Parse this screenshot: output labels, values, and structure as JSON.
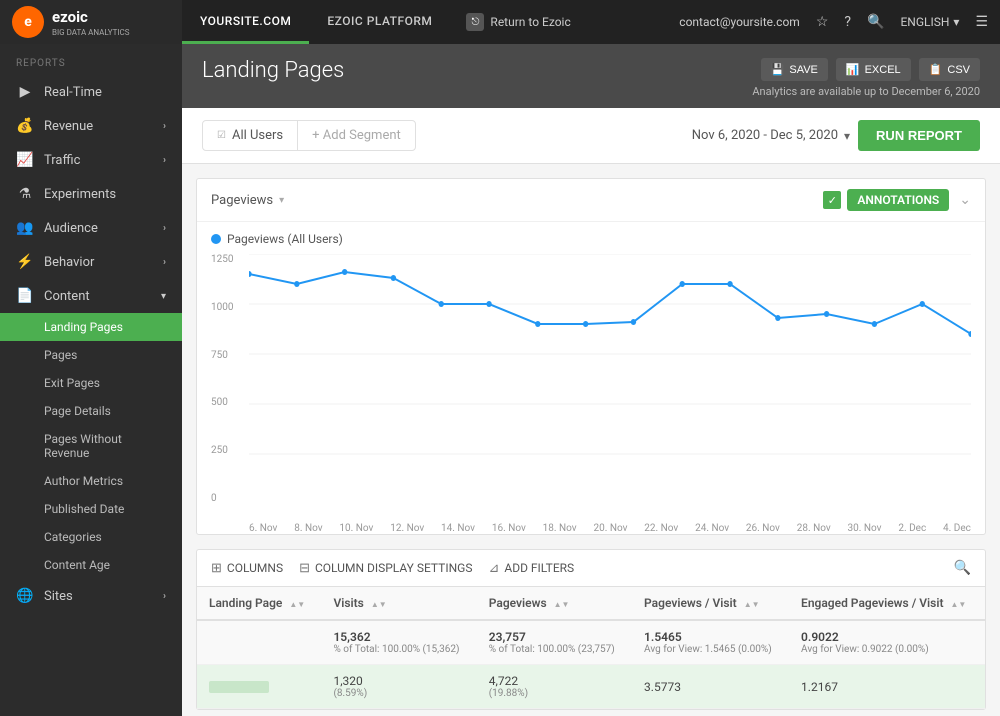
{
  "topNav": {
    "logo": {
      "letter": "e",
      "name": "ezoic",
      "sub": "BIG DATA ANALYTICS"
    },
    "tabs": [
      {
        "label": "YOURSITE.COM",
        "active": true
      },
      {
        "label": "EZOIC PLATFORM",
        "active": false
      }
    ],
    "returnLabel": "Return to Ezoic",
    "email": "contact@yoursite.com",
    "language": "ENGLISH"
  },
  "sidebar": {
    "sectionLabel": "REPORTS",
    "items": [
      {
        "label": "Real-Time",
        "icon": "▶",
        "hasArrow": false
      },
      {
        "label": "Revenue",
        "icon": "$",
        "hasArrow": true
      },
      {
        "label": "Traffic",
        "icon": "↑",
        "hasArrow": true
      },
      {
        "label": "Experiments",
        "icon": "⚗",
        "hasArrow": false
      },
      {
        "label": "Audience",
        "icon": "👥",
        "hasArrow": true
      },
      {
        "label": "Behavior",
        "icon": "⚡",
        "hasArrow": true
      },
      {
        "label": "Content",
        "icon": "📄",
        "hasArrow": true,
        "expanded": true
      }
    ],
    "subItems": [
      {
        "label": "Landing Pages",
        "active": true
      },
      {
        "label": "Pages",
        "active": false
      },
      {
        "label": "Exit Pages",
        "active": false
      },
      {
        "label": "Page Details",
        "active": false
      },
      {
        "label": "Pages Without Revenue",
        "active": false
      },
      {
        "label": "Author Metrics",
        "active": false
      },
      {
        "label": "Published Date",
        "active": false
      },
      {
        "label": "Categories",
        "active": false
      },
      {
        "label": "Content Age",
        "active": false
      }
    ],
    "bottomItem": {
      "label": "Sites",
      "icon": "🌐",
      "hasArrow": true
    }
  },
  "pageTitle": "Landing Pages",
  "headerBtns": {
    "save": "SAVE",
    "excel": "EXCEL",
    "csv": "CSV",
    "analyticsNote": "Analytics are available up to December 6, 2020"
  },
  "filters": {
    "segment": "All Users",
    "addSegment": "+ Add Segment",
    "dateRange": "Nov 6, 2020 - Dec 5, 2020",
    "runReport": "RUN REPORT"
  },
  "chart": {
    "metric": "Pageviews",
    "annotations": "ANNOTATIONS",
    "legend": "Pageviews (All Users)",
    "yLabels": [
      "1250",
      "1000",
      "750",
      "500",
      "250",
      "0"
    ],
    "xLabels": [
      "6. Nov",
      "8. Nov",
      "10. Nov",
      "12. Nov",
      "14. Nov",
      "16. Nov",
      "18. Nov",
      "20. Nov",
      "22. Nov",
      "24. Nov",
      "26. Nov",
      "28. Nov",
      "30. Nov",
      "2. Dec",
      "4. Dec"
    ]
  },
  "tableToolbar": {
    "columns": "COLUMNS",
    "columnDisplay": "COLUMN DISPLAY SETTINGS",
    "addFilters": "ADD FILTERS"
  },
  "tableHeaders": [
    {
      "label": "Landing Page"
    },
    {
      "label": "Visits"
    },
    {
      "label": "Pageviews"
    },
    {
      "label": "Pageviews / Visit"
    },
    {
      "label": "Engaged Pageviews / Visit"
    }
  ],
  "totalsRow": {
    "landingPage": "",
    "visits": "15,362",
    "visitsNote": "% of Total: 100.00% (15,362)",
    "pageviews": "23,757",
    "pageviewsNote": "% of Total: 100.00% (23,757)",
    "pvPerVisit": "1.5465",
    "pvPerVisitNote": "Avg for View: 1.5465 (0.00%)",
    "engagedPv": "0.9022",
    "engagedPvNote": "Avg for View: 0.9022 (0.00%)"
  },
  "dataRows": [
    {
      "landingPage": "",
      "visits": "1,320",
      "visitsNote": "(8.59%)",
      "pageviews": "4,722",
      "pageviewsNote": "(19.88%)",
      "pvPerVisit": "3.5773",
      "engagedPv": "1.2167"
    }
  ]
}
